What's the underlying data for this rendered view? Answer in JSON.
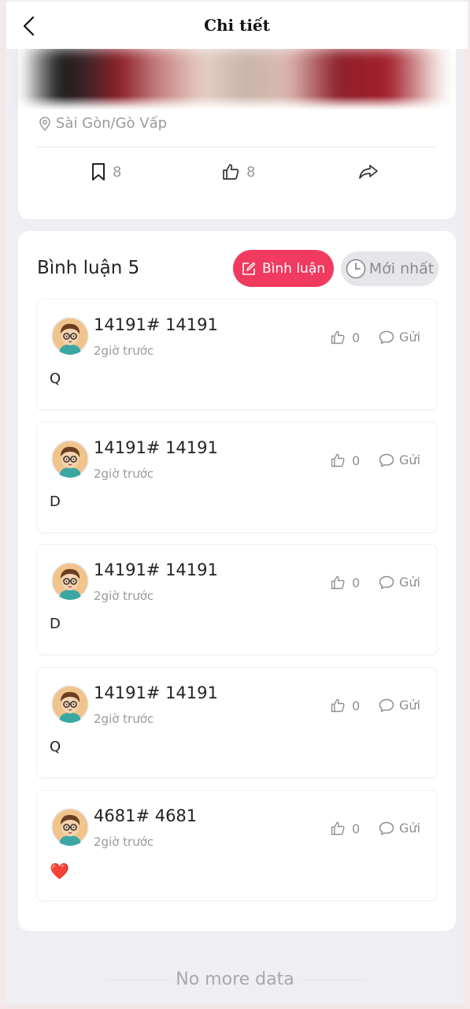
{
  "nav": {
    "title": "Chi tiết"
  },
  "post": {
    "location": "Sài Gòn/Gò Vấp",
    "bookmark_count": "8",
    "like_count": "8"
  },
  "comments_section": {
    "title": "Bình luận 5",
    "comment_button_label": "Bình luận",
    "sort_button_label": "Mới nhất"
  },
  "comments": [
    {
      "user": "14191# 14191",
      "time": "2giờ trước",
      "likes": "0",
      "reply_label": "Gửi",
      "text": "Q"
    },
    {
      "user": "14191# 14191",
      "time": "2giờ trước",
      "likes": "0",
      "reply_label": "Gửi",
      "text": "D"
    },
    {
      "user": "14191# 14191",
      "time": "2giờ trước",
      "likes": "0",
      "reply_label": "Gửi",
      "text": "D"
    },
    {
      "user": "14191# 14191",
      "time": "2giờ trước",
      "likes": "0",
      "reply_label": "Gửi",
      "text": "Q"
    },
    {
      "user": "4681# 4681",
      "time": "2giờ trước",
      "likes": "0",
      "reply_label": "Gửi",
      "text": "❤️"
    }
  ],
  "footer": {
    "text": "No more data"
  },
  "colors": {
    "accent": "#f03a5f",
    "background": "#eeeef3"
  }
}
